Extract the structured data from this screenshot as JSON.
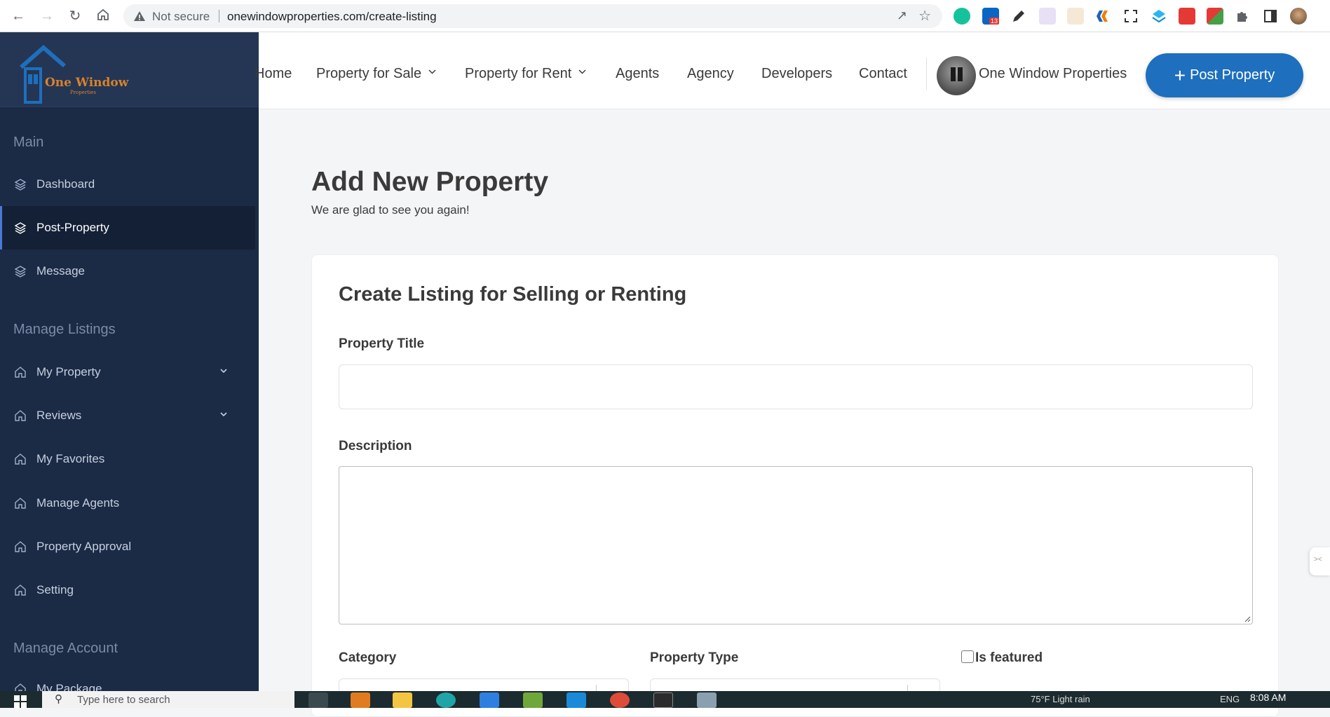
{
  "browser": {
    "security_label": "Not secure",
    "url": "onewindowproperties.com/create-listing",
    "extension_badge": "13"
  },
  "brand": {
    "name": "One Window",
    "tagline": "Properties",
    "accent": "#d9822b"
  },
  "sidebar": {
    "sections": [
      {
        "label": "Main"
      },
      {
        "label": "Manage Listings"
      },
      {
        "label": "Manage Account"
      }
    ],
    "items": [
      {
        "label": "Dashboard",
        "icon": "layers-icon"
      },
      {
        "label": "Post-Property",
        "icon": "layers-icon",
        "active": true
      },
      {
        "label": "Message",
        "icon": "layers-icon"
      },
      {
        "label": "My Property",
        "icon": "home-icon",
        "expandable": true
      },
      {
        "label": "Reviews",
        "icon": "home-icon",
        "expandable": true
      },
      {
        "label": "My Favorites",
        "icon": "home-icon"
      },
      {
        "label": "Manage Agents",
        "icon": "home-icon"
      },
      {
        "label": "Property Approval",
        "icon": "home-icon"
      },
      {
        "label": "Setting",
        "icon": "home-icon"
      },
      {
        "label": "My Package",
        "icon": "home-icon"
      }
    ]
  },
  "topnav": {
    "links": [
      {
        "label": "Home"
      },
      {
        "label": "Property for Sale",
        "dropdown": true
      },
      {
        "label": "Property for Rent",
        "dropdown": true
      },
      {
        "label": "Agents"
      },
      {
        "label": "Agency"
      },
      {
        "label": "Developers"
      },
      {
        "label": "Contact"
      }
    ],
    "user_name": "One Window Properties",
    "post_button": "Post Property",
    "button_color": "#1e6fbd"
  },
  "main": {
    "title": "Add New Property",
    "subtitle": "We are glad to see you again!",
    "card": {
      "title": "Create Listing for Selling or Renting",
      "fields": {
        "property_title": {
          "label": "Property Title",
          "value": ""
        },
        "description": {
          "label": "Description",
          "value": ""
        },
        "category": {
          "label": "Category"
        },
        "property_type": {
          "label": "Property Type"
        },
        "is_featured": {
          "label": "Is featured",
          "checked": false
        }
      }
    }
  },
  "taskbar": {
    "search_placeholder": "Type here to search",
    "time": "8:08 AM",
    "weather": "75°F Light rain",
    "lang": "ENG"
  }
}
